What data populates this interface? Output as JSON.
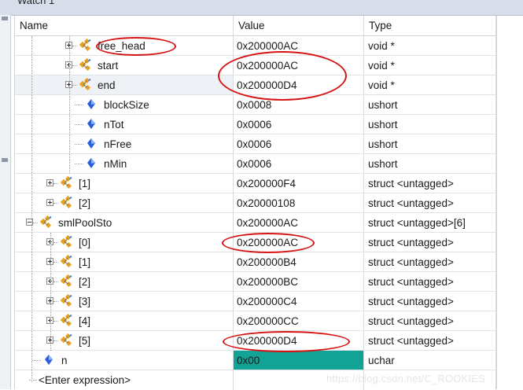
{
  "window": {
    "title": "Watch 1"
  },
  "columns": {
    "name": "Name",
    "value": "Value",
    "type": "Type"
  },
  "rows": [
    {
      "name": "free_head",
      "value": "0x200000AC",
      "type": "void *"
    },
    {
      "name": "start",
      "value": "0x200000AC",
      "type": "void *"
    },
    {
      "name": "end",
      "value": "0x200000D4",
      "type": "void *"
    },
    {
      "name": "blockSize",
      "value": "0x0008",
      "type": "ushort"
    },
    {
      "name": "nTot",
      "value": "0x0006",
      "type": "ushort"
    },
    {
      "name": "nFree",
      "value": "0x0006",
      "type": "ushort"
    },
    {
      "name": "nMin",
      "value": "0x0006",
      "type": "ushort"
    },
    {
      "name": "[1]",
      "value": "0x200000F4",
      "type": "struct <untagged>"
    },
    {
      "name": "[2]",
      "value": "0x20000108",
      "type": "struct <untagged>"
    },
    {
      "name": "smlPoolSto",
      "value": "0x200000AC",
      "type": "struct <untagged>[6]"
    },
    {
      "name": "[0]",
      "value": "0x200000AC",
      "type": "struct <untagged>"
    },
    {
      "name": "[1]",
      "value": "0x200000B4",
      "type": "struct <untagged>"
    },
    {
      "name": "[2]",
      "value": "0x200000BC",
      "type": "struct <untagged>"
    },
    {
      "name": "[3]",
      "value": "0x200000C4",
      "type": "struct <untagged>"
    },
    {
      "name": "[4]",
      "value": "0x200000CC",
      "type": "struct <untagged>"
    },
    {
      "name": "[5]",
      "value": "0x200000D4",
      "type": "struct <untagged>"
    },
    {
      "name": "n",
      "value": "0x00",
      "type": "uchar"
    }
  ],
  "enter_expression": "<Enter expression>",
  "watermark": "https://blog.csdn.net/C_ROOKIES",
  "colors": {
    "highlight_value": "#12a394",
    "annotation_red": "#d61414",
    "struct_icon": "#e8a21a",
    "member_icon": "#2b5fd9"
  }
}
